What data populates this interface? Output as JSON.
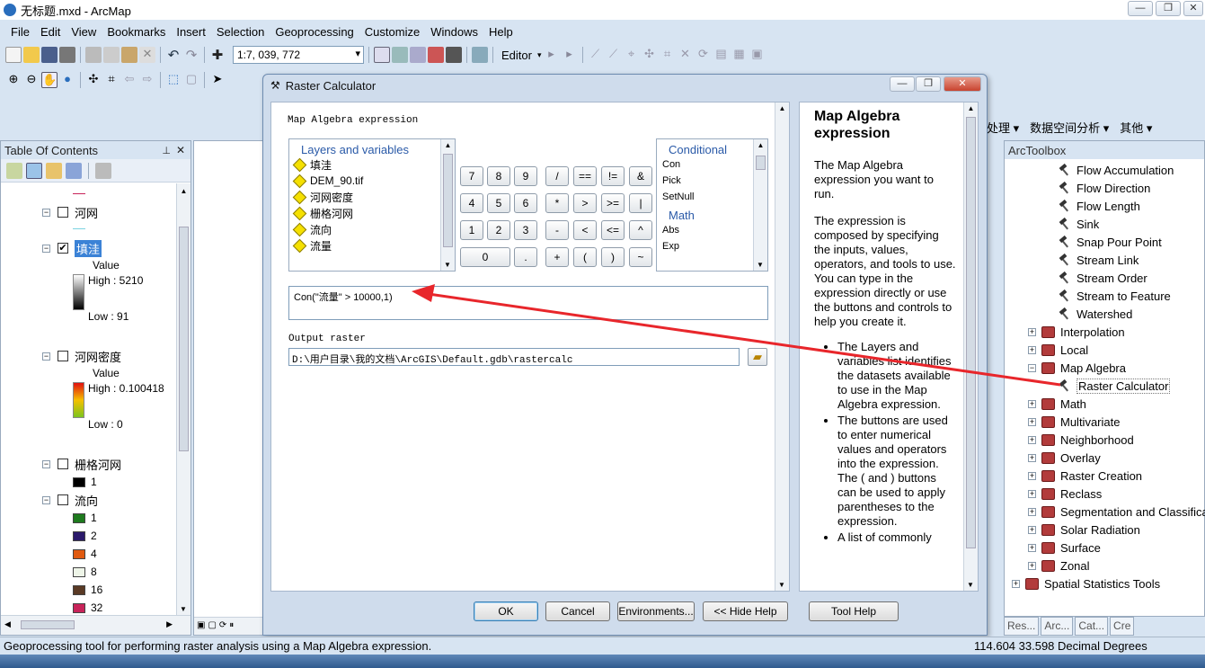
{
  "window": {
    "title": "无标题.mxd - ArcMap"
  },
  "menu": [
    "File",
    "Edit",
    "View",
    "Bookmarks",
    "Insert",
    "Selection",
    "Geoprocessing",
    "Customize",
    "Windows",
    "Help"
  ],
  "toolbar": {
    "scale": "1:7, 039, 772",
    "editor_label": "Editor",
    "right_items": [
      "处理",
      "数据空间分析",
      "其他"
    ]
  },
  "toc": {
    "title": "Table Of Contents",
    "layers": [
      {
        "name": "河网",
        "checked": false
      },
      {
        "name": "填洼",
        "checked": true,
        "legend_title": "Value",
        "high": "High : 5210",
        "low": "Low : 91"
      },
      {
        "name": "河网密度",
        "checked": false,
        "legend_title": "Value",
        "high": "High : 0.100418",
        "low": "Low : 0"
      },
      {
        "name": "栅格河网",
        "checked": false,
        "classes": [
          "1"
        ]
      },
      {
        "name": "流向",
        "checked": false,
        "classes": [
          "1",
          "2",
          "4",
          "8",
          "16",
          "32"
        ]
      }
    ],
    "flow_colors": [
      "#1e7a1e",
      "#2b1a6b",
      "#e05a10",
      "#eef5e8",
      "#5a3a25",
      "#c8245a"
    ]
  },
  "dialog": {
    "title": "Raster Calculator",
    "section_label": "Map Algebra expression",
    "layers_header": "Layers and variables",
    "layers": [
      "填洼",
      "DEM_90.tif",
      "河网密度",
      "栅格河网",
      "流向",
      "流量"
    ],
    "keypad": {
      "row1": [
        "7",
        "8",
        "9",
        "/",
        "==",
        "!=",
        "&"
      ],
      "row2": [
        "4",
        "5",
        "6",
        "*",
        ">",
        ">=",
        "|"
      ],
      "row3": [
        "1",
        "2",
        "3",
        "-",
        "<",
        "<=",
        "^"
      ],
      "row4": [
        "0",
        ".",
        "+",
        "(",
        ")",
        "~"
      ]
    },
    "conditional_header": "Conditional",
    "conditional": [
      "Con",
      "Pick",
      "SetNull"
    ],
    "math_header": "Math",
    "math": [
      "Abs",
      "Exp"
    ],
    "expression": "Con(\"流量\" > 10000,1)",
    "output_label": "Output raster",
    "output_value": "D:\\用户目录\\我的文档\\ArcGIS\\Default.gdb\\rastercalc",
    "buttons": {
      "ok": "OK",
      "cancel": "Cancel",
      "env": "Environments...",
      "hide_help": "<< Hide Help",
      "tool_help": "Tool Help"
    },
    "help": {
      "title": "Map Algebra expression",
      "p1": "The Map Algebra expression you want to run.",
      "p2": "The expression is composed by specifying the inputs, values, operators, and tools to use. You can type in the expression directly or use the buttons and controls to help you create it.",
      "bullets": [
        "The Layers and variables list identifies the datasets available to use in the Map Algebra expression.",
        "The buttons are used to enter numerical values and operators into the expression. The ( and ) buttons can be used to apply parentheses to the expression.",
        "A list of commonly"
      ]
    }
  },
  "toolbox": {
    "title": "ArcToolbox",
    "tools_hydrology": [
      "Flow Accumulation",
      "Flow Direction",
      "Flow Length",
      "Sink",
      "Snap Pour Point",
      "Stream Link",
      "Stream Order",
      "Stream to Feature",
      "Watershed"
    ],
    "sets_a": [
      "Interpolation",
      "Local"
    ],
    "map_algebra": "Map Algebra",
    "raster_calc": "Raster Calculator",
    "sets_b": [
      "Math",
      "Multivariate",
      "Neighborhood",
      "Overlay",
      "Raster Creation",
      "Reclass",
      "Segmentation and Classification",
      "Solar Radiation",
      "Surface",
      "Zonal"
    ],
    "spatial_stats": "Spatial Statistics Tools",
    "tabs": [
      "Res...",
      "Arc...",
      "Cat...",
      "Cre"
    ]
  },
  "status": {
    "message": "Geoprocessing tool for performing raster analysis using a Map Algebra expression.",
    "coords": "114.604  33.598 Decimal Degrees"
  },
  "colors": {
    "arrow": "#e8262b",
    "accent": "#2a6ebd"
  }
}
